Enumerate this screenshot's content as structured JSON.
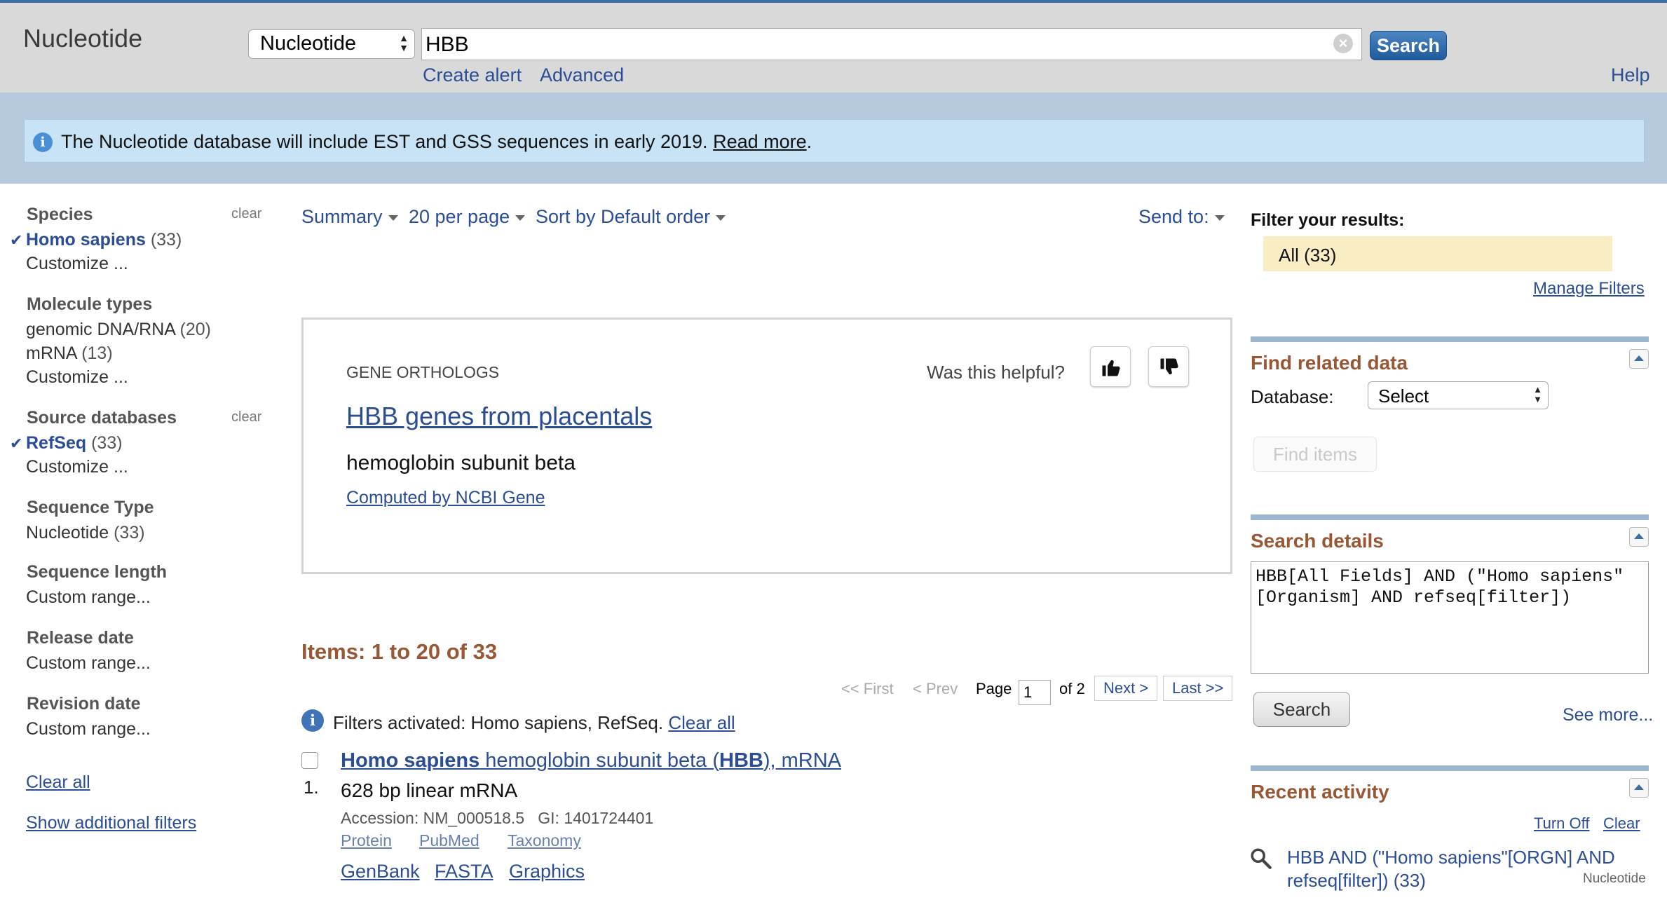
{
  "header": {
    "app_title": "Nucleotide",
    "db_select_value": "Nucleotide",
    "search_value": "HBB",
    "search_button": "Search",
    "create_alert": "Create alert",
    "advanced": "Advanced",
    "help": "Help"
  },
  "banner": {
    "text": "The Nucleotide database will include EST and GSS sequences in early 2019.",
    "link": "Read more",
    "suffix": "."
  },
  "sidebar": {
    "species": {
      "heading": "Species",
      "clear": "clear",
      "selected_label": "Homo sapiens",
      "selected_count": "(33)",
      "customize": "Customize ..."
    },
    "molecule_types": {
      "heading": "Molecule types",
      "items": [
        {
          "label": "genomic DNA/RNA",
          "count": "(20)"
        },
        {
          "label": "mRNA",
          "count": "(13)"
        }
      ],
      "customize": "Customize ..."
    },
    "source_databases": {
      "heading": "Source databases",
      "clear": "clear",
      "selected_label": "RefSeq",
      "selected_count": "(33)",
      "customize": "Customize ..."
    },
    "sequence_type": {
      "heading": "Sequence Type",
      "item_label": "Nucleotide",
      "item_count": "(33)"
    },
    "sequence_length": {
      "heading": "Sequence length",
      "item": "Custom range..."
    },
    "release_date": {
      "heading": "Release date",
      "item": "Custom range..."
    },
    "revision_date": {
      "heading": "Revision date",
      "item": "Custom range..."
    },
    "clear_all": "Clear all",
    "show_additional": "Show additional filters"
  },
  "toolbar": {
    "summary": "Summary",
    "per_page": "20 per page",
    "sort": "Sort by Default order",
    "send_to": "Send to:"
  },
  "orthologs": {
    "label": "GENE ORTHOLOGS",
    "link": "HBB genes from placentals",
    "description": "hemoglobin subunit beta",
    "source": "Computed by NCBI Gene",
    "helpful": "Was this helpful?"
  },
  "results": {
    "heading": "Items: 1 to 20 of 33",
    "pager": {
      "first": "<< First",
      "prev": "< Prev",
      "page_label": "Page",
      "page_value": "1",
      "of": "of 2",
      "next": "Next >",
      "last": "Last >>"
    },
    "filters_label": "Filters activated: Homo sapiens, RefSeq.",
    "filters_clear": "Clear all",
    "items": [
      {
        "number": "1.",
        "title_part1": "Homo sapiens",
        "title_part2": " hemoglobin subunit beta (",
        "title_part3": "HBB",
        "title_part4": "), mRNA",
        "subtitle": "628 bp linear mRNA",
        "accession": "Accession: NM_000518.5   GI: 1401724401",
        "small_links": [
          "Protein",
          "PubMed",
          "Taxonomy"
        ],
        "links": [
          "GenBank",
          "FASTA",
          "Graphics"
        ]
      }
    ]
  },
  "right": {
    "filter_heading": "Filter your results:",
    "filter_all": "All (33)",
    "manage_filters": "Manage Filters",
    "find_related": {
      "heading": "Find related data",
      "db_label": "Database:",
      "db_value": "Select",
      "find_items": "Find items"
    },
    "search_details": {
      "heading": "Search details",
      "query": "HBB[All Fields] AND (\"Homo sapiens\"[Organism] AND refseq[filter])",
      "search_button": "Search",
      "see_more": "See more..."
    },
    "recent_activity": {
      "heading": "Recent activity",
      "turn_off": "Turn Off",
      "clear": "Clear",
      "entry": "HBB AND (\"Homo sapiens\"[ORGN] AND refseq[filter]) (33)",
      "entry_db": "Nucleotide"
    }
  },
  "colors": {
    "header_bg": "#d9d9d9",
    "banner_bg": "#c7e3f5",
    "link": "#2a4d94",
    "portlet_heading": "#985735",
    "filter_highlight": "#f9eec3"
  }
}
